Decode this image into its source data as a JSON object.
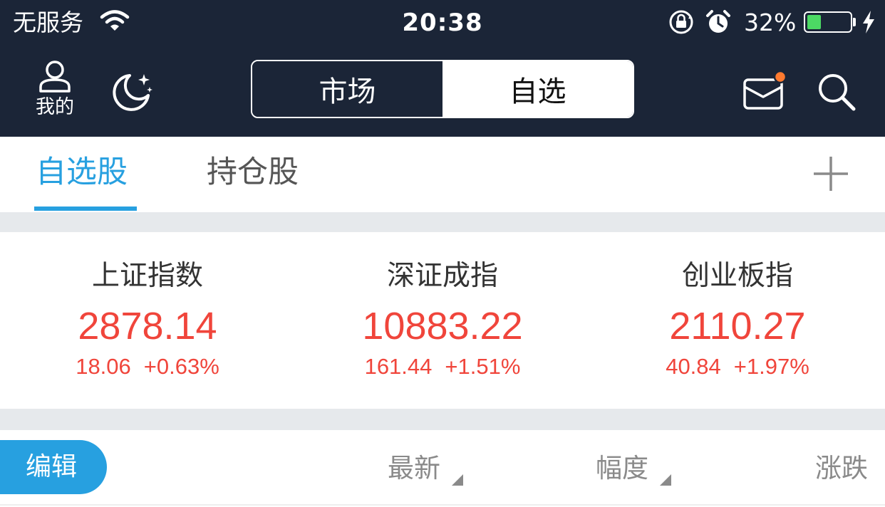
{
  "status_bar": {
    "carrier": "无服务",
    "time": "20:38",
    "battery_percent": "32%",
    "battery_level": 0.32,
    "icons": [
      "wifi-icon",
      "rotation-lock-icon",
      "alarm-icon",
      "battery-icon",
      "charging-bolt-icon"
    ]
  },
  "nav": {
    "me_label": "我的",
    "segments": [
      {
        "label": "市场",
        "selected": false
      },
      {
        "label": "自选",
        "selected": true
      }
    ],
    "icons": [
      "user-icon",
      "night-mode-icon",
      "mail-icon",
      "search-icon"
    ],
    "mail_badge_color": "#ff7a2f"
  },
  "sub_tabs": {
    "items": [
      {
        "label": "自选股",
        "active": true
      },
      {
        "label": "持仓股",
        "active": false
      }
    ],
    "add_icon": "plus-icon"
  },
  "indices": [
    {
      "name": "上证指数",
      "value": "2878.14",
      "change": "18.06",
      "change_pct": "+0.63%"
    },
    {
      "name": "深证成指",
      "value": "10883.22",
      "change": "161.44",
      "change_pct": "+1.51%"
    },
    {
      "name": "创业板指",
      "value": "2110.27",
      "change": "40.84",
      "change_pct": "+1.97%"
    }
  ],
  "list_header": {
    "edit_label": "编辑",
    "columns": [
      "最新",
      "幅度",
      "涨跌"
    ]
  },
  "colors": {
    "header_bg": "#1b2537",
    "accent": "#27a0e0",
    "up_red": "#f0453b",
    "divider_gray": "#e6e9ec",
    "battery_green": "#4cd964"
  }
}
